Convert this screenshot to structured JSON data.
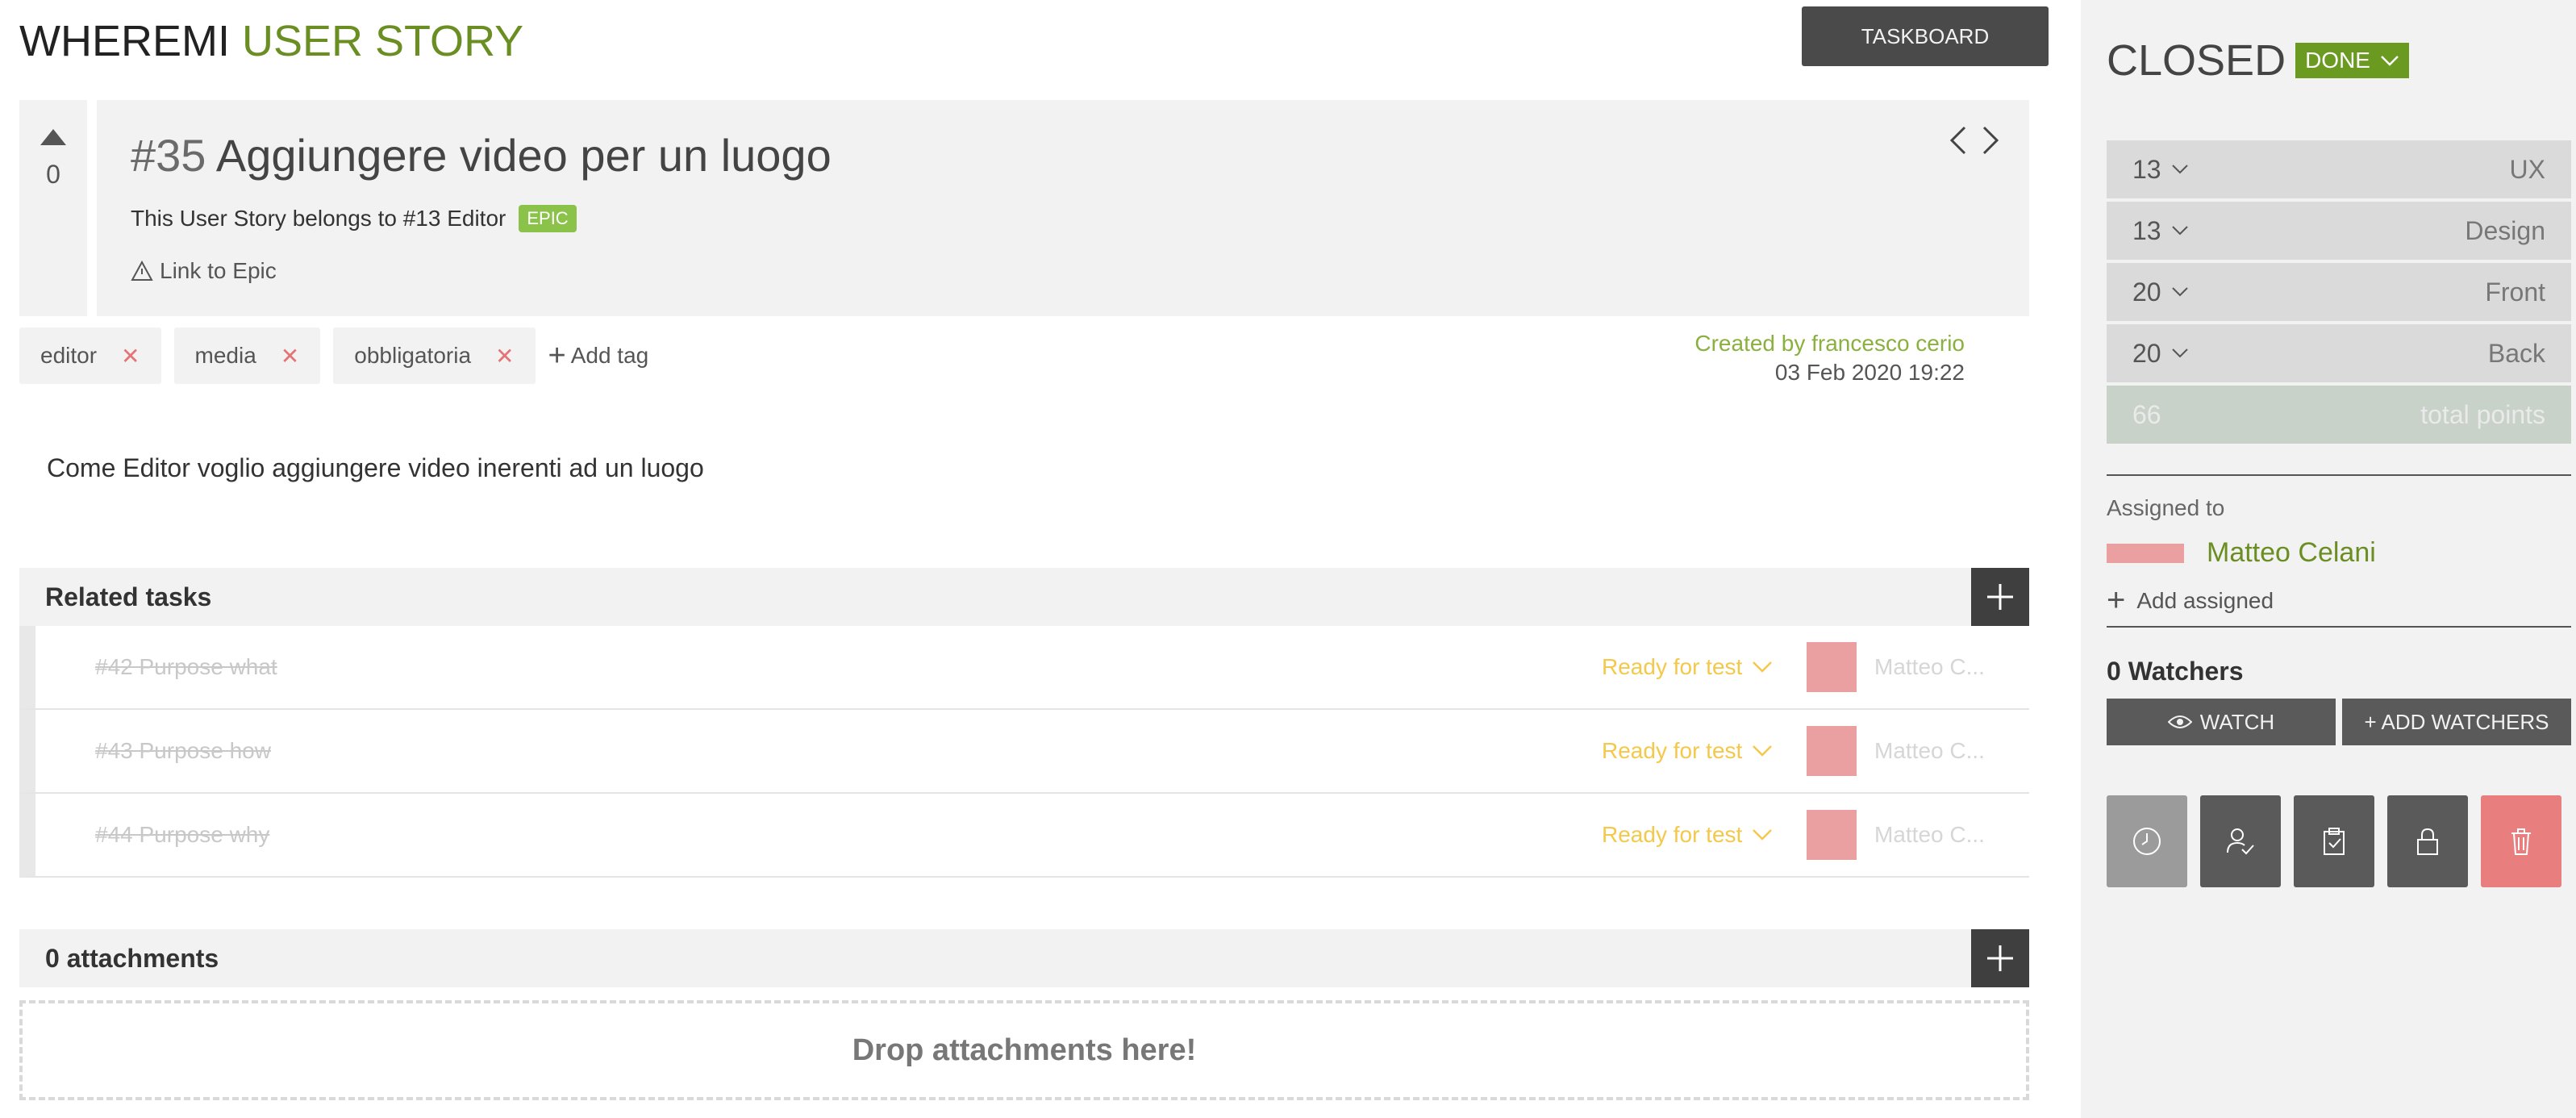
{
  "header": {
    "app_name": "WHEREMI",
    "item_kind": "USER STORY",
    "taskboard_label": "TASKBOARD"
  },
  "story": {
    "votes": "0",
    "ref": "#35",
    "title": "Aggiungere video per un luogo",
    "belongs_text": "This User Story belongs to #13 Editor",
    "epic_badge": "EPIC",
    "link_epic": "Link to Epic",
    "description": "Come Editor voglio aggiungere video inerenti ad un luogo"
  },
  "tags": {
    "items": [
      "editor",
      "media",
      "obbligatoria"
    ],
    "add_label": "Add tag"
  },
  "created": {
    "by": "Created by francesco cerio",
    "date": "03 Feb 2020 19:22"
  },
  "related_tasks": {
    "title": "Related tasks",
    "rows": [
      {
        "name": "#42 Purpose what",
        "status": "Ready for test",
        "user": "Matteo C..."
      },
      {
        "name": "#43 Purpose how",
        "status": "Ready for test",
        "user": "Matteo C..."
      },
      {
        "name": "#44 Purpose why",
        "status": "Ready for test",
        "user": "Matteo C..."
      }
    ]
  },
  "attachments": {
    "title": "0 attachments",
    "drop_text": "Drop attachments here!"
  },
  "sidebar": {
    "status": "CLOSED",
    "status_badge": "DONE",
    "points": [
      {
        "value": "13",
        "role": "UX"
      },
      {
        "value": "13",
        "role": "Design"
      },
      {
        "value": "20",
        "role": "Front"
      },
      {
        "value": "20",
        "role": "Back"
      }
    ],
    "total": {
      "value": "66",
      "label": "total points"
    },
    "assigned_label": "Assigned to",
    "assigned_name": "Matteo Celani",
    "add_assigned": "Add assigned",
    "watchers_title": "0 Watchers",
    "watch_label": "WATCH",
    "add_watchers_label": "+ ADD WATCHERS"
  },
  "colors": {
    "accent_green": "#6b8e23",
    "done_green": "#6b9a21",
    "status_yellow": "#f4c84a",
    "avatar_pink": "#eaa0a0",
    "delete_red": "#e97e7e"
  }
}
